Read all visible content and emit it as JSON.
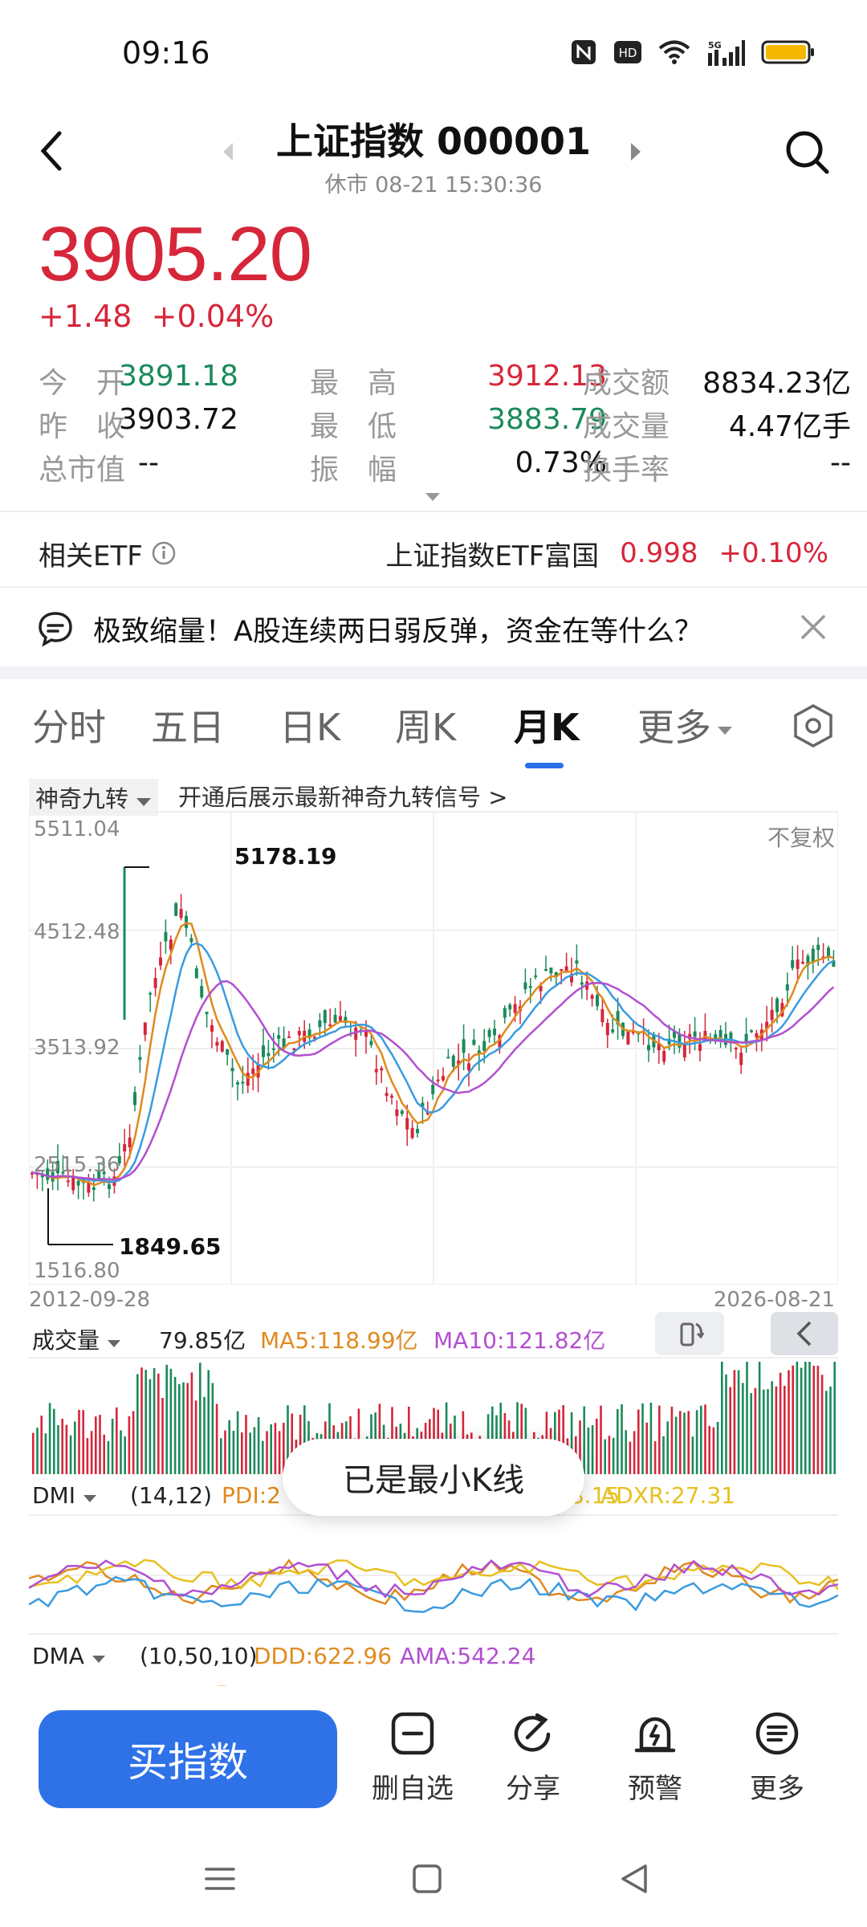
{
  "status": {
    "time": "09:16"
  },
  "header": {
    "title": "上证指数 000001",
    "subtitle": "休市  08-21 15:30:36"
  },
  "quote": {
    "price": "3905.20",
    "change": "+1.48",
    "change_pct": "+0.04%",
    "rows": [
      [
        {
          "label": "今　开",
          "value": "3891.18",
          "color": "green"
        },
        {
          "label": "最　高",
          "value": "3912.13",
          "color": "red"
        },
        {
          "label": "成交额",
          "value": "8834.23亿",
          "color": "black"
        }
      ],
      [
        {
          "label": "昨　收",
          "value": "3903.72",
          "color": "black"
        },
        {
          "label": "最　低",
          "value": "3883.79",
          "color": "green"
        },
        {
          "label": "成交量",
          "value": "4.47亿手",
          "color": "black"
        }
      ],
      [
        {
          "label": "总市值",
          "value": "--",
          "color": "black"
        },
        {
          "label": "振　幅",
          "value": "0.73%",
          "color": "black"
        },
        {
          "label": "换手率",
          "value": "--",
          "color": "black"
        }
      ]
    ]
  },
  "etf": {
    "label": "相关ETF",
    "name": "上证指数ETF富国",
    "price": "0.998",
    "pct": "+0.10%"
  },
  "news": {
    "text": "极致缩量！A股连续两日弱反弹，资金在等什么？"
  },
  "tabs": [
    "分时",
    "五日",
    "日K",
    "周K",
    "月K",
    "更多"
  ],
  "active_tab": "月K",
  "signal": {
    "dropdown": "神奇九转",
    "hint": "开通后展示最新神奇九转信号 >"
  },
  "chart": {
    "right_label": "不复权",
    "y_ticks": [
      "5511.04",
      "4512.48",
      "3513.92",
      "2515.36",
      "1516.80"
    ],
    "max_label": "5178.19",
    "min_label": "1849.65",
    "date_start": "2012-09-28",
    "date_end": "2026-08-21"
  },
  "volume": {
    "label": "成交量",
    "value": "79.85亿",
    "ma5": "MA5:118.99亿",
    "ma10": "MA10:121.82亿"
  },
  "dmi": {
    "label": "DMI",
    "params": "(14,12)",
    "pdi": "PDI:2",
    "mid": "18.15",
    "adxr": "ADXR:27.31"
  },
  "dma": {
    "label": "DMA",
    "params": "(10,50,10)",
    "ddd": "DDD:622.96",
    "ama": "AMA:542.24"
  },
  "toast": "已是最小K线",
  "bottom": {
    "buy": "买指数",
    "actions": [
      "删自选",
      "分享",
      "预警",
      "更多"
    ]
  },
  "colors": {
    "red": "#d6263a",
    "green": "#1a8a5a",
    "blue": "#2f72e8",
    "ma_orange": "#e08a1e",
    "ma_blue": "#3a9be0",
    "ma_purple": "#b24fd0"
  }
}
